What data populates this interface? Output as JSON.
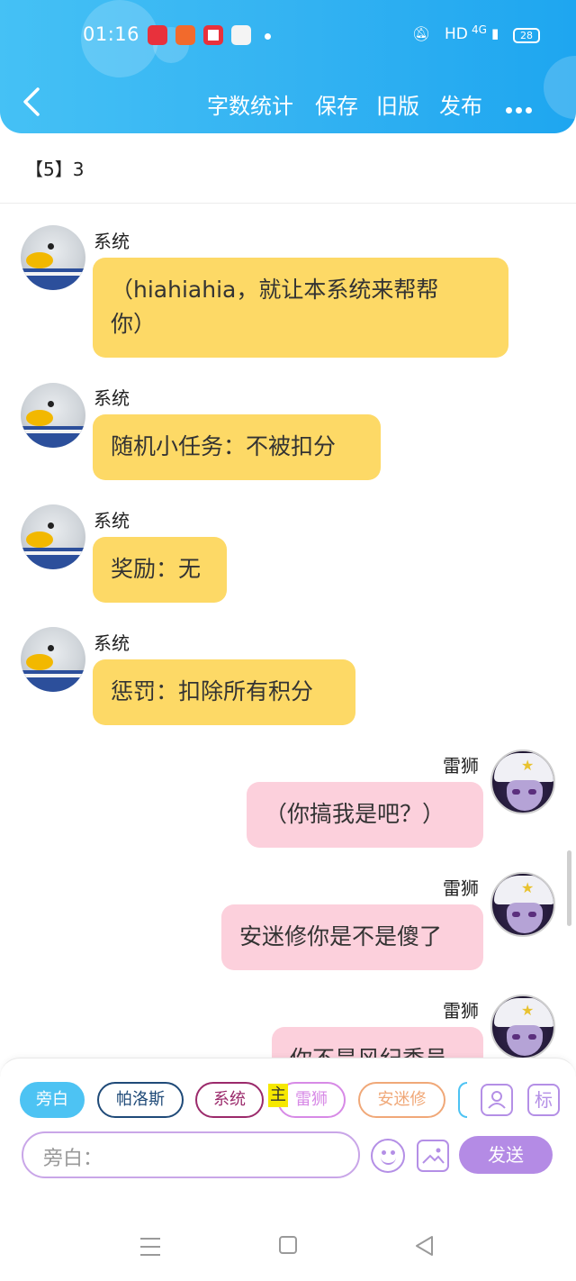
{
  "status_bar": {
    "time": "01:16",
    "network": "HD",
    "signal": "4G",
    "battery": "28"
  },
  "header": {
    "back_icon": "chevron-left-icon",
    "actions": [
      "字数统计",
      "保存",
      "旧版",
      "发布"
    ],
    "more_icon": "more-dots-icon"
  },
  "chapter": {
    "title": "【5】3"
  },
  "messages": [
    {
      "sender": "系统",
      "text": "（hiahiahia，就让本系统来帮帮你）",
      "lines": [
        "（hiahiahia，就让本系统来帮帮",
        "你）"
      ],
      "side": "left"
    },
    {
      "sender": "系统",
      "text": "随机小任务：不被扣分",
      "side": "left"
    },
    {
      "sender": "系统",
      "text": "奖励：无",
      "side": "left"
    },
    {
      "sender": "系统",
      "text": "惩罚：扣除所有积分",
      "side": "left"
    },
    {
      "sender": "雷狮",
      "text": "（你搞我是吧？）",
      "side": "right"
    },
    {
      "sender": "雷狮",
      "text": "安迷修你是不是傻了",
      "side": "right"
    },
    {
      "sender": "雷狮",
      "text": "你不是风纪委员",
      "side": "right"
    }
  ],
  "roles": {
    "chips": [
      "旁白",
      "帕洛斯",
      "系统",
      "雷狮",
      "安迷修"
    ],
    "selected": "旁白",
    "main_marker": "主",
    "avatar_button_icon": "person-card-icon",
    "tag_button": "标"
  },
  "composer": {
    "input_label": "旁白：",
    "emoji_icon": "emoji-icon",
    "image_icon": "image-icon",
    "send_label": "发送"
  },
  "colors": {
    "header": "#34b3f2",
    "system_bubble": "#fdd966",
    "user_bubble": "#fcd0dc",
    "accent_purple": "#b48be5"
  }
}
